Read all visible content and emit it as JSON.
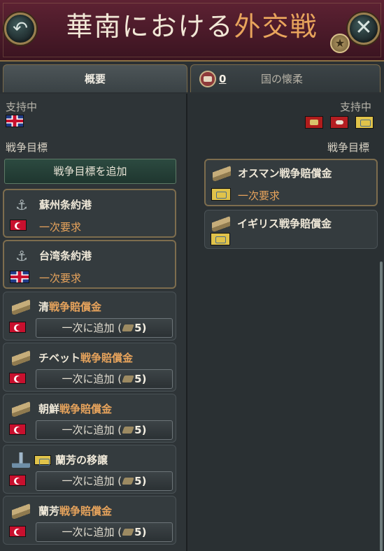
{
  "header": {
    "title_part1": "華南における",
    "title_part2": "外交戦",
    "back_glyph": "↶",
    "close_glyph": "✕",
    "star_glyph": "★"
  },
  "tabs": {
    "overview": "概要",
    "pacify_count": "0",
    "pacify_label": "国の懐柔"
  },
  "left": {
    "supporting_label": "支持中",
    "war_goals_label": "戦争目標",
    "add_goal_button": "戦争目標を追加",
    "goals": [
      {
        "title": "蘇州条約港",
        "status": "一次要求",
        "icon": "anchor-icon",
        "flag": "turkey"
      },
      {
        "title": "台湾条約港",
        "status": "一次要求",
        "icon": "anchor-icon",
        "flag": "uk"
      },
      {
        "title_prefix": "清",
        "title_accent": "戦争賠償金",
        "button": "一次に追加 (",
        "cost": "5)",
        "icon": "gold-bars-icon",
        "flag": "turkey"
      },
      {
        "title_prefix": "チベット",
        "title_accent": "戦争賠償金",
        "button": "一次に追加 (",
        "cost": "5)",
        "icon": "gold-bars-icon",
        "flag": "turkey"
      },
      {
        "title_prefix": "朝鮮",
        "title_accent": "戦争賠償金",
        "button": "一次に追加 (",
        "cost": "5)",
        "icon": "gold-bars-icon",
        "flag": "turkey"
      },
      {
        "title_prefix": "蘭芳",
        "title_accent": "の移譲",
        "button": "一次に追加 (",
        "cost": "5)",
        "icon": "transfer-icon",
        "flag": "turkey"
      },
      {
        "title_prefix": "蘭芳",
        "title_accent": "戦争賠償金",
        "button": "一次に追加 (",
        "cost": "5)",
        "icon": "gold-bars-icon",
        "flag": "turkey"
      }
    ]
  },
  "right": {
    "supporting_label": "支持中",
    "war_goals_label": "戦争目標",
    "goals": [
      {
        "title": "オスマン戦争賠償金",
        "status": "一次要求",
        "icon": "gold-bars-icon"
      },
      {
        "title": "イギリス戦争賠償金",
        "icon": "gold-bars-icon"
      }
    ]
  },
  "colors": {
    "accent": "#e8a45c",
    "header_bg": "#4a1a29",
    "panel_bg": "#2e3437"
  }
}
